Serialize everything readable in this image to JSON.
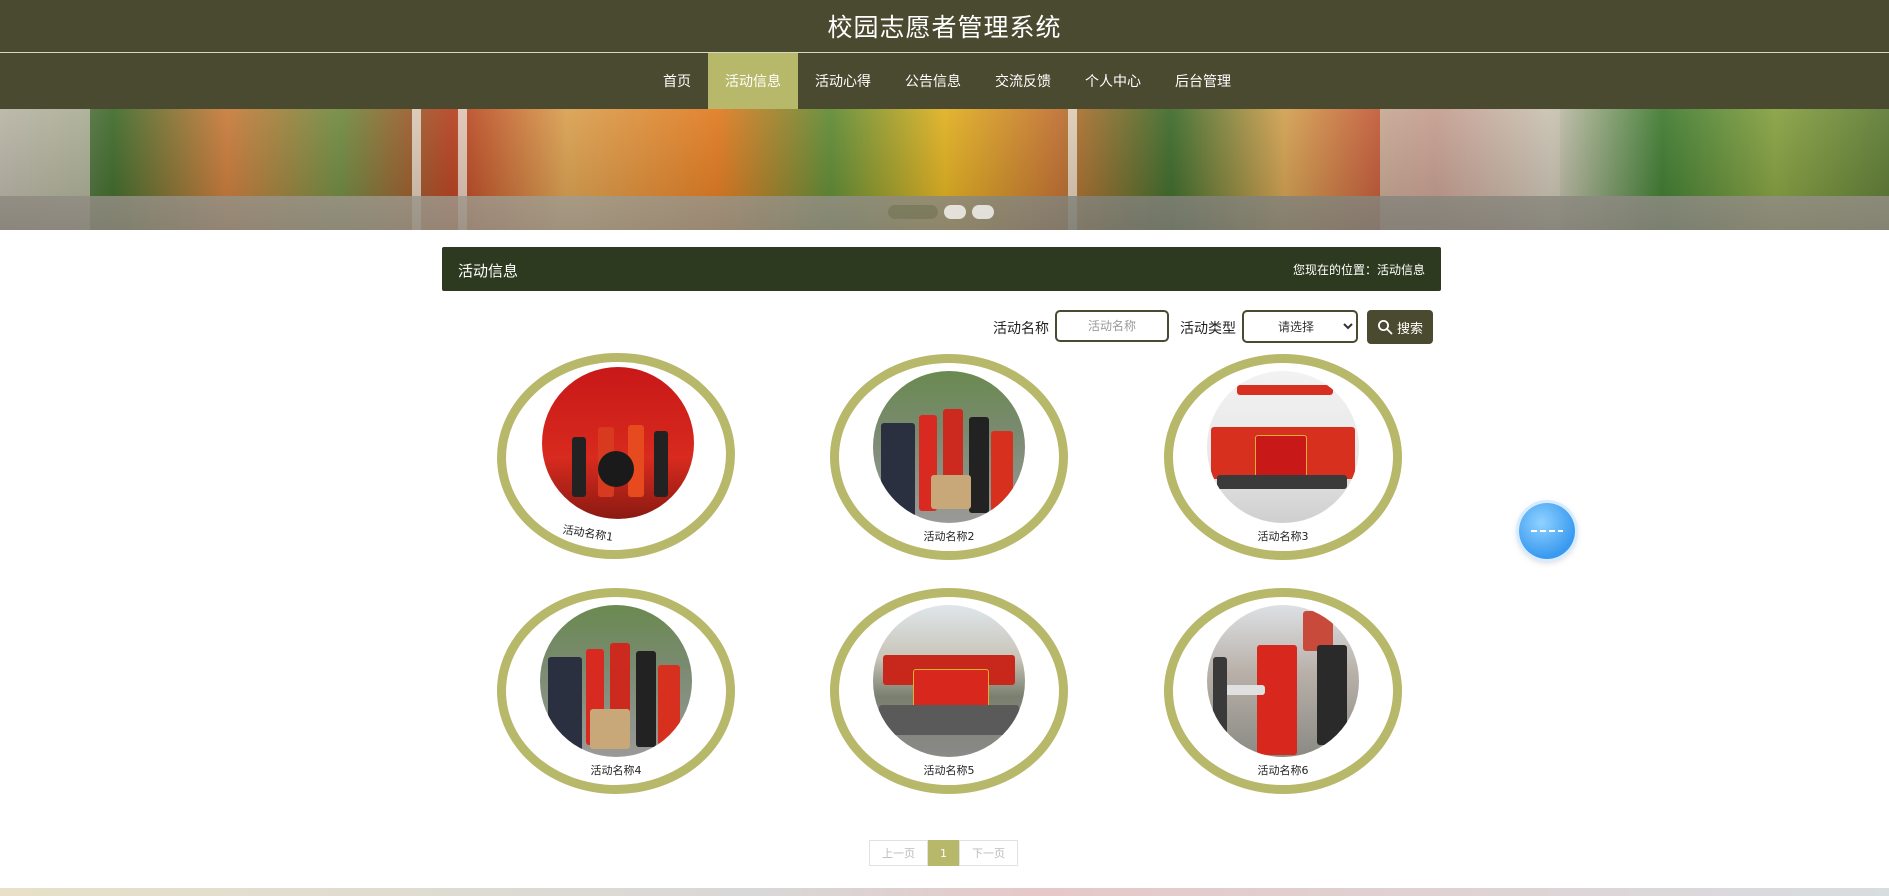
{
  "site": {
    "title": "校园志愿者管理系统"
  },
  "nav": {
    "items": [
      {
        "label": "首页"
      },
      {
        "label": "活动信息"
      },
      {
        "label": "活动心得"
      },
      {
        "label": "公告信息"
      },
      {
        "label": "交流反馈"
      },
      {
        "label": "个人中心"
      },
      {
        "label": "后台管理"
      }
    ],
    "active_index": 1
  },
  "section": {
    "title": "活动信息",
    "breadcrumb_prefix": "您现在的位置：",
    "breadcrumb_current": "活动信息"
  },
  "search": {
    "name_label": "活动名称",
    "name_placeholder": "活动名称",
    "type_label": "活动类型",
    "type_selected": "请选择",
    "button_label": "搜索"
  },
  "activities": [
    {
      "name": "活动名称1"
    },
    {
      "name": "活动名称2"
    },
    {
      "name": "活动名称3"
    },
    {
      "name": "活动名称4"
    },
    {
      "name": "活动名称5"
    },
    {
      "name": "活动名称6"
    }
  ],
  "pagination": {
    "prev": "上一页",
    "current": "1",
    "next": "下一页"
  },
  "colors": {
    "header_bg": "#4a4a30",
    "accent": "#b7b86a",
    "section_bg": "#2e3a20"
  }
}
